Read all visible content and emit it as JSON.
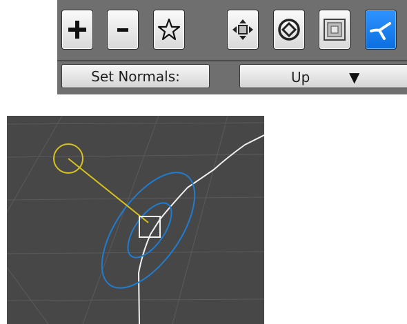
{
  "toolbar": {
    "tools": [
      {
        "name": "add-point",
        "icon": "plus-icon"
      },
      {
        "name": "remove-point",
        "icon": "minus-icon"
      },
      {
        "name": "favorite",
        "icon": "star-icon"
      },
      {
        "name": "move",
        "icon": "move-arrows-icon"
      },
      {
        "name": "rotate",
        "icon": "rotate-icon"
      },
      {
        "name": "scale",
        "icon": "scale-icon"
      },
      {
        "name": "set-normals",
        "icon": "normal-direction-icon",
        "active": true
      }
    ],
    "active_color": "#0a7cf0",
    "set_normals_label": "Set Normals:",
    "direction_value": "Up",
    "dropdown_arrow": "▼"
  },
  "viewport": {
    "background": "#474747",
    "curve_color": "#f2f2f2",
    "gizmo_color": "#1f7dd1",
    "handle_color": "#d8c21e",
    "selection_marker": "square"
  }
}
